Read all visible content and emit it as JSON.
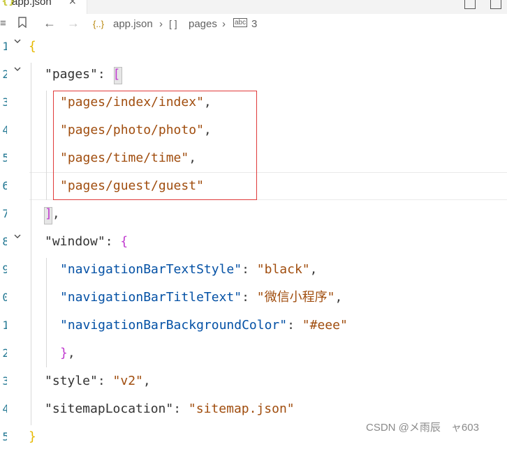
{
  "tab": {
    "file_icon": "{}",
    "file_name": "app.json",
    "close": "×"
  },
  "breadcrumb": {
    "items": [
      {
        "icon": "{..}",
        "label": "app.json"
      },
      {
        "icon": "[ ]",
        "label": "pages"
      },
      {
        "icon": "abc",
        "label": "3"
      }
    ]
  },
  "editor": {
    "line_numbers": [
      "1",
      "2",
      "3",
      "4",
      "5",
      "6",
      "7",
      "8",
      "9",
      "0",
      "1",
      "2",
      "3",
      "4",
      "5"
    ],
    "lines": [
      {
        "text": "{"
      },
      {
        "key": "\"pages\"",
        "rest": ": ["
      },
      {
        "value": "\"pages/index/index\"",
        "rest": ","
      },
      {
        "value": "\"pages/photo/photo\"",
        "rest": ","
      },
      {
        "value": "\"pages/time/time\"",
        "rest": ","
      },
      {
        "value": "\"pages/guest/guest\"",
        "rest": ""
      },
      {
        "text": "],"
      },
      {
        "key": "\"window\"",
        "rest": ": {"
      },
      {
        "key": "\"navigationBarTextStyle\"",
        "sep": ": ",
        "value": "\"black\"",
        "rest": ","
      },
      {
        "key": "\"navigationBarTitleText\"",
        "sep": ": ",
        "value": "\"微信小程序\"",
        "rest": ","
      },
      {
        "key": "\"navigationBarBackgroundColor\"",
        "sep": ": ",
        "value": "\"#eee\"",
        "rest": ""
      },
      {
        "text": "},"
      },
      {
        "key": "\"style\"",
        "sep": ": ",
        "value": "\"v2\"",
        "rest": ","
      },
      {
        "key": "\"sitemapLocation\"",
        "sep": ": ",
        "value": "\"sitemap.json\"",
        "rest": ""
      },
      {
        "text": "}"
      }
    ]
  },
  "watermark": "CSDN @メ雨辰　ャ603",
  "colors": {
    "accent_box": "#e03a3a",
    "line_number": "#237893",
    "string": "#a04d0e",
    "property": "#0451a5"
  }
}
